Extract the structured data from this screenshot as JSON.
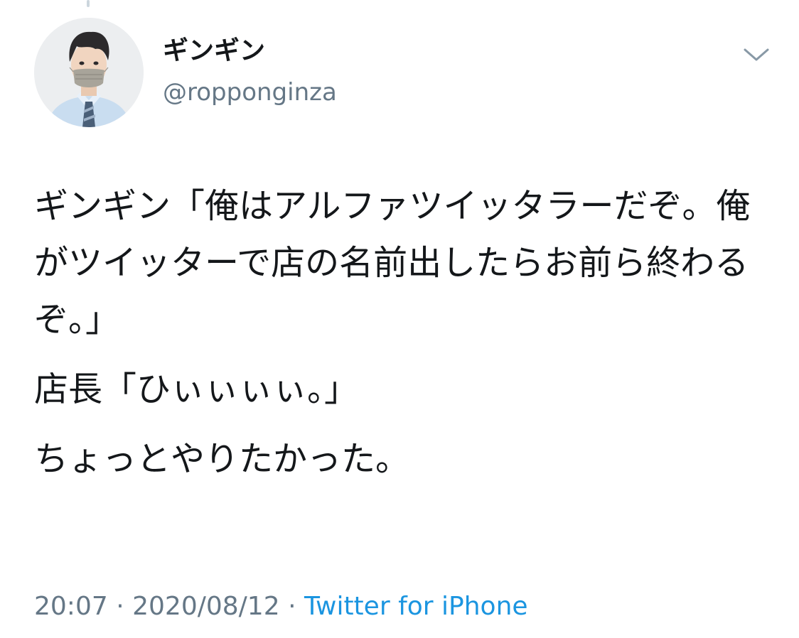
{
  "tweet": {
    "author": {
      "display_name": "ギンギン",
      "handle": "@ropponginza",
      "avatar_icon": "user-avatar-icon"
    },
    "menu_icon": "chevron-down-icon",
    "body": [
      "ギンギン「俺はアルファツイッタラーだぞ。俺がツイッターで店の名前出したらお前ら終わるぞ。」",
      "店長「ひぃぃぃぃ。」",
      "ちょっとやりたかった。"
    ],
    "time": "20:07",
    "separator": "·",
    "date": "2020/08/12",
    "source": "Twitter for iPhone"
  },
  "colors": {
    "text": "#14171a",
    "secondary": "#657786",
    "link": "#1b95e0",
    "thread_line": "#ccd6dd"
  }
}
